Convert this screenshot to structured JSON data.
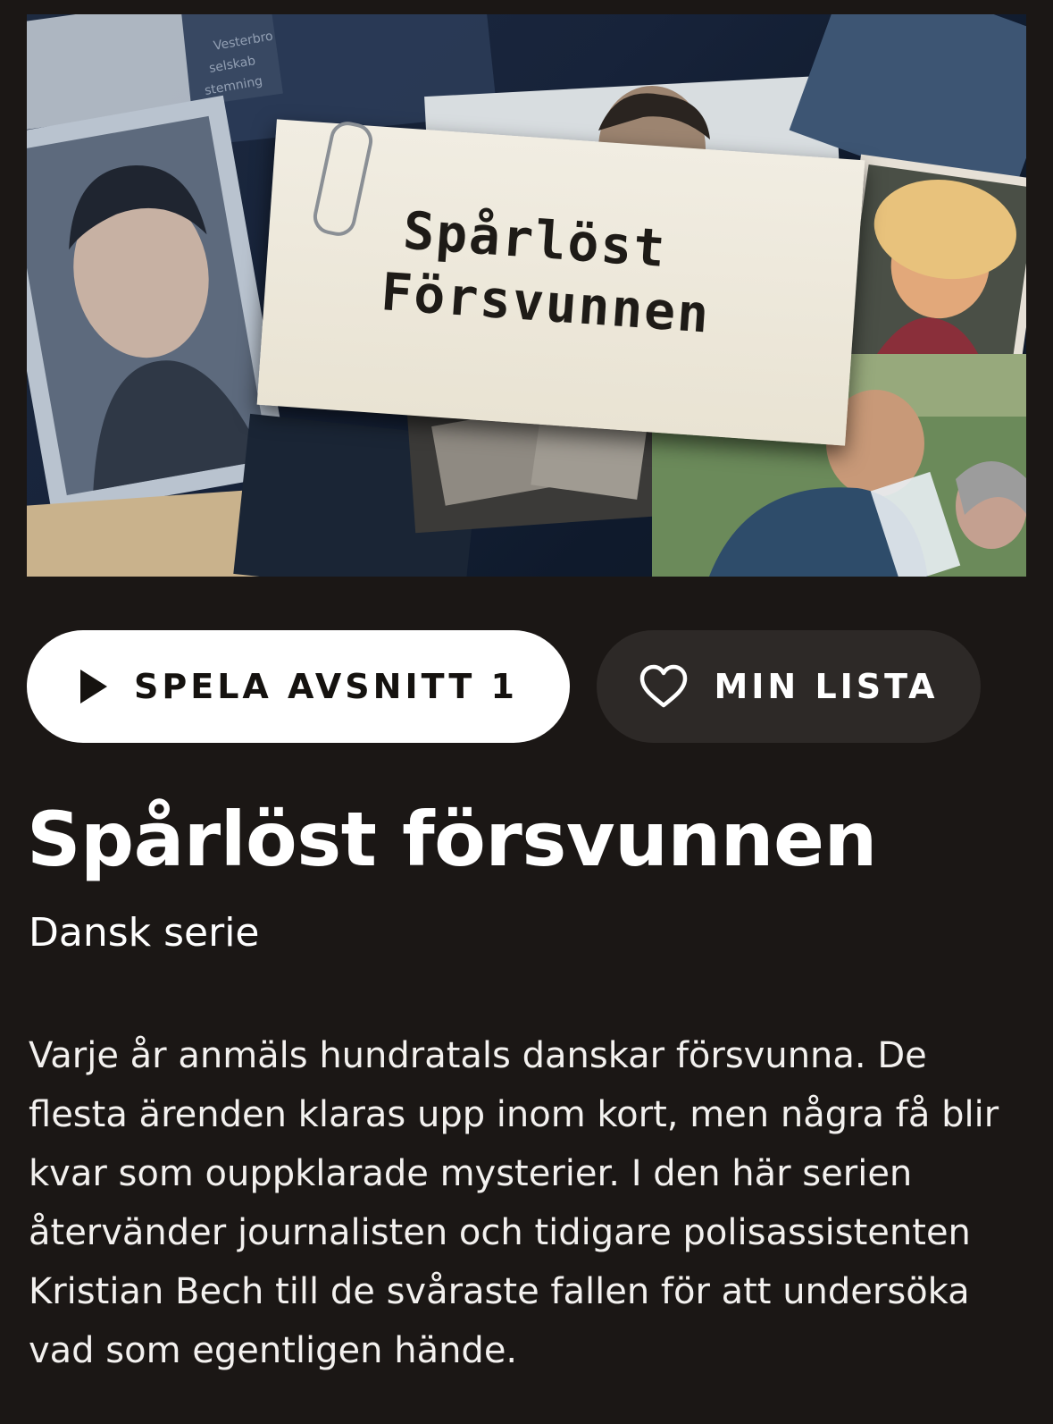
{
  "hero": {
    "card_line1": "Spårlöst",
    "card_line2": "Försvunnen",
    "image_alt": "Spårlöst Försvunnen key art"
  },
  "actions": {
    "play_label": "SPELA AVSNITT 1",
    "list_label": "MIN LISTA",
    "play_icon": "play-icon",
    "list_icon": "heart-outline-icon"
  },
  "show": {
    "title": "Spårlöst försvunnen",
    "subtitle": "Dansk serie",
    "description": "Varje år anmäls hundratals danskar försvunna. De flesta ärenden klaras upp inom kort, men några få blir kvar som ouppklarade mysterier. I den här serien återvänder journalisten och tidigare polisassistenten Kristian Bech till de svåraste fallen för att undersöka vad som egentligen hände."
  },
  "colors": {
    "background": "#1b1715",
    "play_button_bg": "#ffffff",
    "list_button_bg": "#2d2927",
    "text": "#ffffff"
  }
}
